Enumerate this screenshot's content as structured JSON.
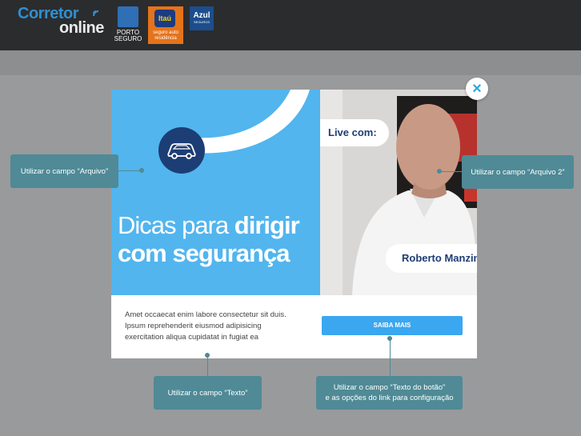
{
  "header": {
    "logo_line1": "Corretor",
    "logo_line2": "online",
    "partners": [
      {
        "name": "PORTO SEGURO",
        "line1": "PORTO",
        "line2": "SEGURO"
      },
      {
        "name": "Itaú",
        "mark": "Itaú",
        "line1": "seguro auto",
        "line2": "residência"
      },
      {
        "name": "Azul",
        "line1": "Azul",
        "line2": "SEGUROS"
      }
    ]
  },
  "modal": {
    "headline_normal": "Dicas para ",
    "headline_bold1": "dirigir",
    "headline_bold2": "com segurança",
    "live_label": "Live com:",
    "person_name": "Roberto Manzini",
    "body_text": "Amet occaecat enim labore consectetur sit duis. Ipsum reprehenderit eiusmod adipisicing exercitation aliqua cupidatat in fugiat ea",
    "cta_label": "SAIBA MAIS",
    "close_icon": "×"
  },
  "callouts": {
    "arquivo": "Utilizar o campo “Arquivo”",
    "arquivo2": "Utilizar o campo “Arquivo 2”",
    "texto": "Utilizar o campo “Texto”",
    "botao_line1": "Utilizar o campo “Texto do botão”",
    "botao_line2": "e as opções do link para configuração"
  },
  "colors": {
    "accent": "#3aa7f0",
    "banner": "#52b5ee",
    "navy": "#1d3d75",
    "callout": "#4f8a96"
  }
}
